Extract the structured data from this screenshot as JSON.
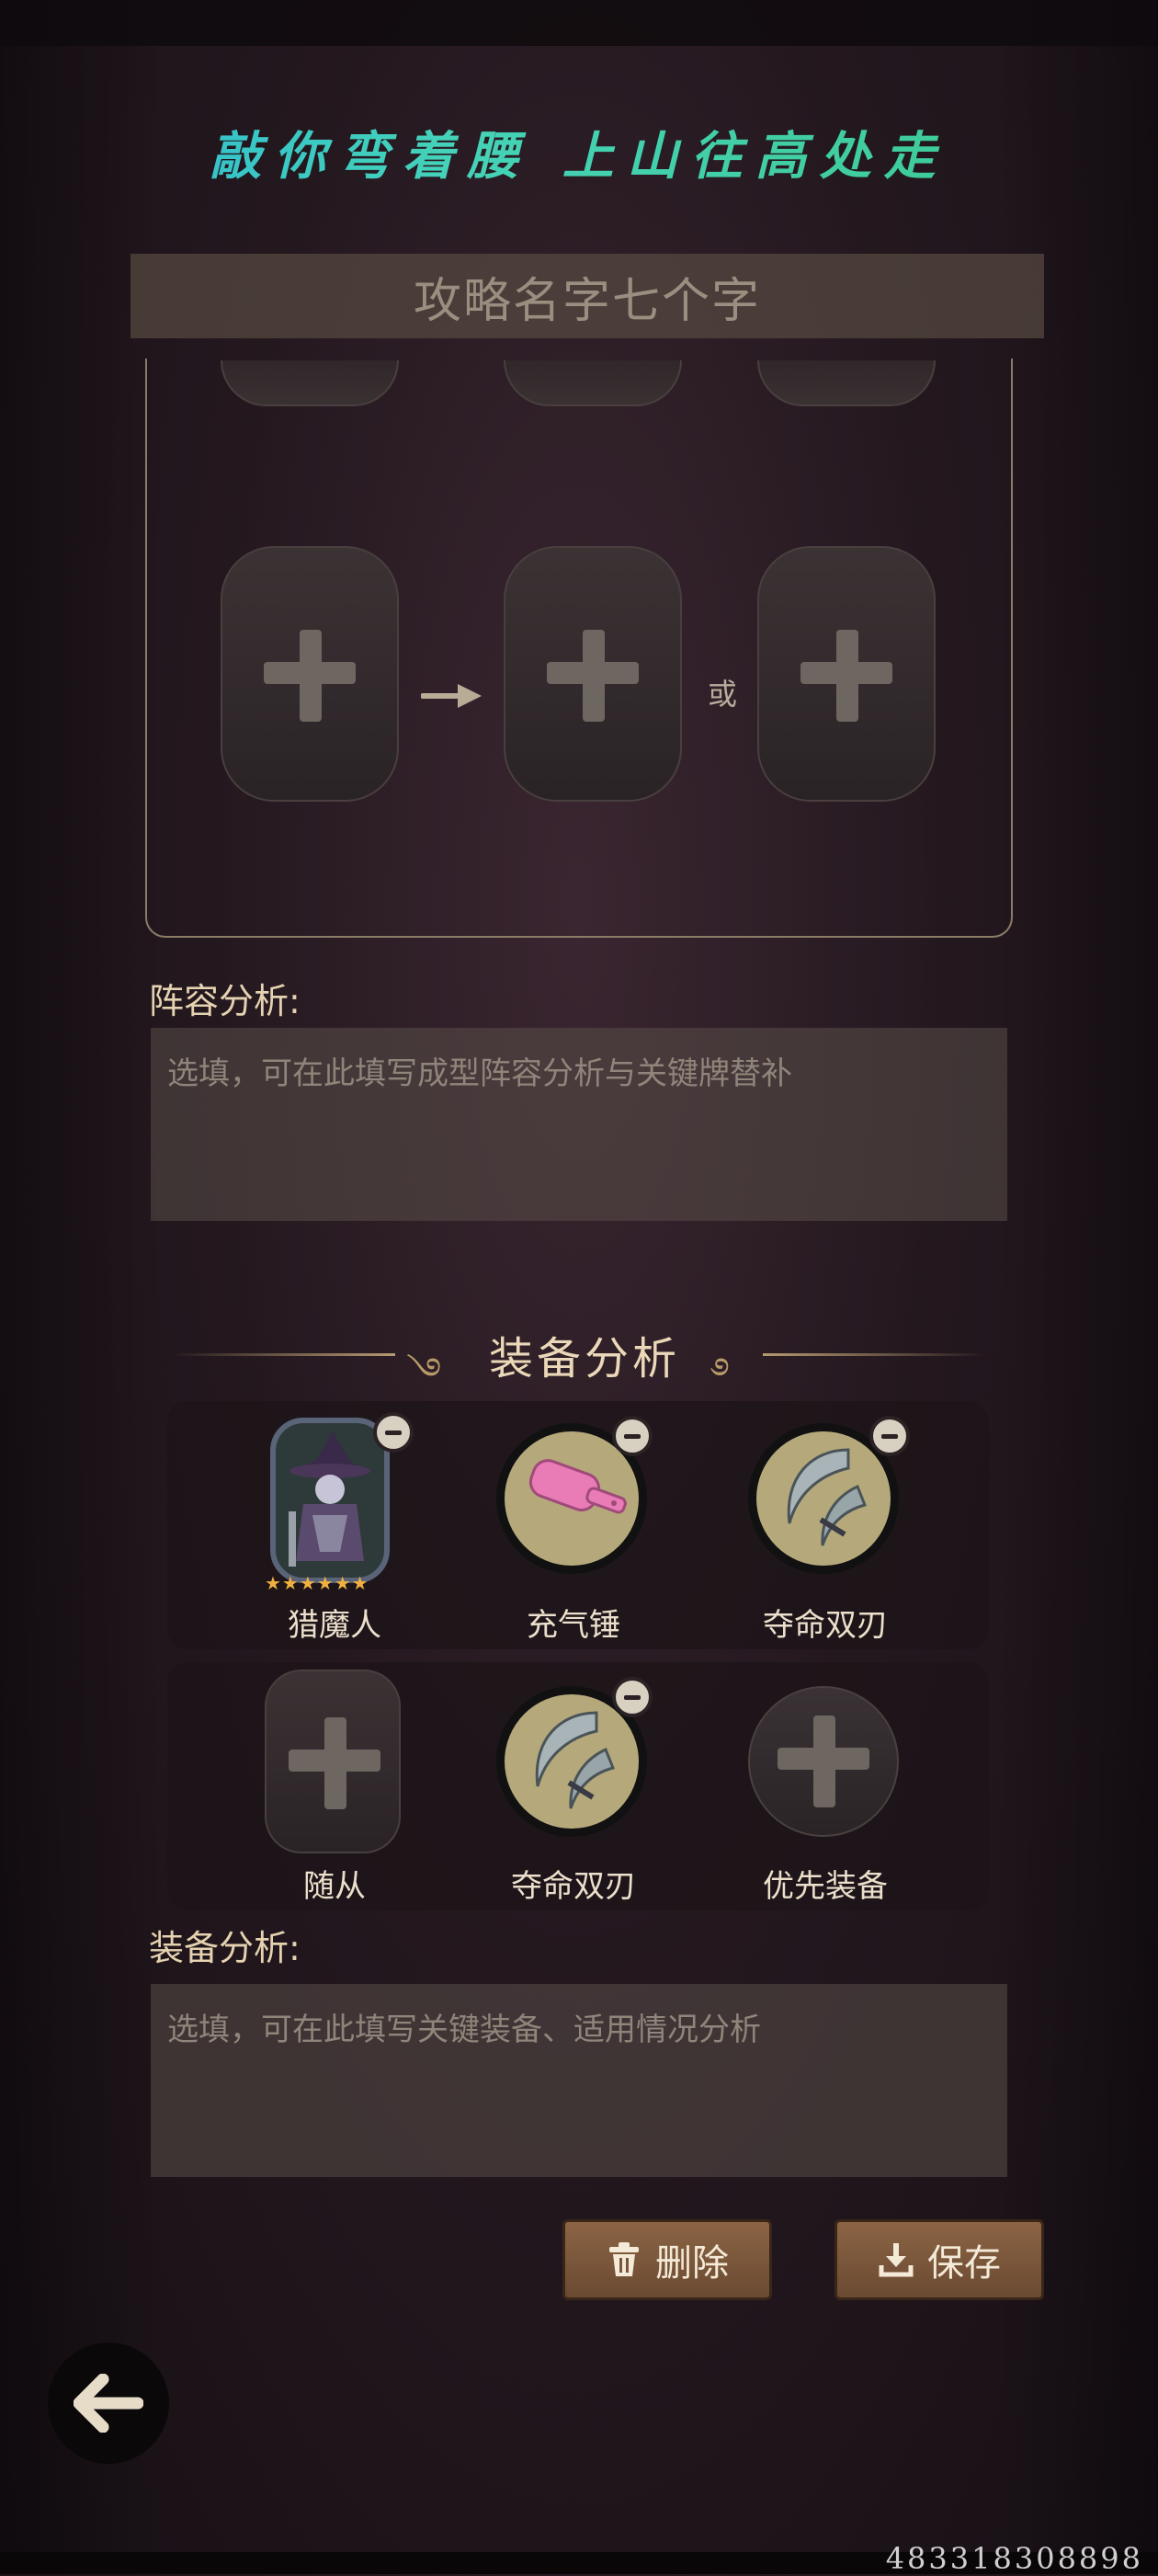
{
  "header": {
    "slogan": "敲你弯着腰 上山往高处走",
    "strategy_name_placeholder": "攻略名字七个字"
  },
  "lineup": {
    "or_label": "或",
    "analysis_label": "阵容分析:",
    "analysis_placeholder": "选填，可在此填写成型阵容分析与关键牌替补"
  },
  "equipment": {
    "section_title": "装备分析",
    "row1": [
      {
        "label": "猎魔人",
        "kind": "hero",
        "stars": "★★★★★★"
      },
      {
        "label": "充气锤",
        "kind": "item-hammer"
      },
      {
        "label": "夺命双刃",
        "kind": "item-blades"
      }
    ],
    "row2": [
      {
        "label": "随从",
        "kind": "empty-slot"
      },
      {
        "label": "夺命双刃",
        "kind": "item-blades"
      },
      {
        "label": "优先装备",
        "kind": "empty-circle"
      }
    ],
    "analysis_label": "装备分析:",
    "analysis_placeholder": "选填，可在此填写关键装备、适用情况分析"
  },
  "actions": {
    "delete_label": "删除",
    "save_label": "保存"
  },
  "icons": {
    "back": "arrow-left-icon",
    "delete": "trash-icon",
    "save": "download-icon",
    "add": "plus-icon",
    "remove": "minus-icon"
  },
  "footer": {
    "serial": "483318308898"
  },
  "colors": {
    "slogan_start": "#2bb7d6",
    "slogan_end": "#3cc98d",
    "button_brown": "#8c6444",
    "accent_gold": "#b49a70"
  }
}
